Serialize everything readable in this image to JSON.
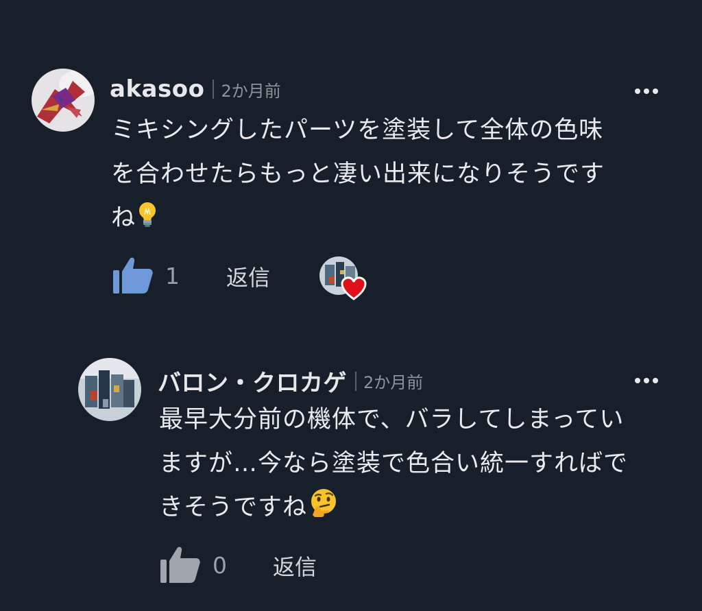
{
  "comments": [
    {
      "username": "akasoo",
      "time": "2か月前",
      "body_lines": [
        "ミキシングしたパーツを塗装して全体の色味",
        "を合わせたらもっと凄い出来になりそうです",
        "ね"
      ],
      "body_emoji": "light-bulb",
      "likes": "1",
      "liked": true,
      "reply_label": "返信",
      "creator_hearted": true
    },
    {
      "username": "バロン・クロカゲ",
      "time": "2か月前",
      "body_lines": [
        "最早大分前の機体で、バラしてしまってい",
        "ますが…今なら塗装で色合い統一すればで",
        "きそうですね"
      ],
      "body_emoji": "thinking-face",
      "likes": "0",
      "liked": false,
      "reply_label": "返信",
      "creator_hearted": false
    }
  ],
  "colors": {
    "background": "#17202a",
    "liked_thumb": "#6e98d8",
    "unliked_thumb": "#a0a6ad",
    "heart": "#e0101a"
  }
}
